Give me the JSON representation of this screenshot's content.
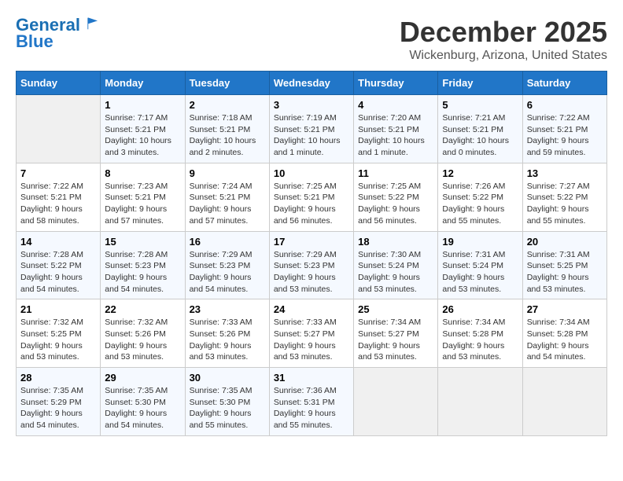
{
  "header": {
    "logo_line1": "General",
    "logo_line2": "Blue",
    "title": "December 2025",
    "subtitle": "Wickenburg, Arizona, United States"
  },
  "days_of_week": [
    "Sunday",
    "Monday",
    "Tuesday",
    "Wednesday",
    "Thursday",
    "Friday",
    "Saturday"
  ],
  "weeks": [
    [
      {
        "day": "",
        "detail": ""
      },
      {
        "day": "1",
        "detail": "Sunrise: 7:17 AM\nSunset: 5:21 PM\nDaylight: 10 hours\nand 3 minutes."
      },
      {
        "day": "2",
        "detail": "Sunrise: 7:18 AM\nSunset: 5:21 PM\nDaylight: 10 hours\nand 2 minutes."
      },
      {
        "day": "3",
        "detail": "Sunrise: 7:19 AM\nSunset: 5:21 PM\nDaylight: 10 hours\nand 1 minute."
      },
      {
        "day": "4",
        "detail": "Sunrise: 7:20 AM\nSunset: 5:21 PM\nDaylight: 10 hours\nand 1 minute."
      },
      {
        "day": "5",
        "detail": "Sunrise: 7:21 AM\nSunset: 5:21 PM\nDaylight: 10 hours\nand 0 minutes."
      },
      {
        "day": "6",
        "detail": "Sunrise: 7:22 AM\nSunset: 5:21 PM\nDaylight: 9 hours\nand 59 minutes."
      }
    ],
    [
      {
        "day": "7",
        "detail": "Sunrise: 7:22 AM\nSunset: 5:21 PM\nDaylight: 9 hours\nand 58 minutes."
      },
      {
        "day": "8",
        "detail": "Sunrise: 7:23 AM\nSunset: 5:21 PM\nDaylight: 9 hours\nand 57 minutes."
      },
      {
        "day": "9",
        "detail": "Sunrise: 7:24 AM\nSunset: 5:21 PM\nDaylight: 9 hours\nand 57 minutes."
      },
      {
        "day": "10",
        "detail": "Sunrise: 7:25 AM\nSunset: 5:21 PM\nDaylight: 9 hours\nand 56 minutes."
      },
      {
        "day": "11",
        "detail": "Sunrise: 7:25 AM\nSunset: 5:22 PM\nDaylight: 9 hours\nand 56 minutes."
      },
      {
        "day": "12",
        "detail": "Sunrise: 7:26 AM\nSunset: 5:22 PM\nDaylight: 9 hours\nand 55 minutes."
      },
      {
        "day": "13",
        "detail": "Sunrise: 7:27 AM\nSunset: 5:22 PM\nDaylight: 9 hours\nand 55 minutes."
      }
    ],
    [
      {
        "day": "14",
        "detail": "Sunrise: 7:28 AM\nSunset: 5:22 PM\nDaylight: 9 hours\nand 54 minutes."
      },
      {
        "day": "15",
        "detail": "Sunrise: 7:28 AM\nSunset: 5:23 PM\nDaylight: 9 hours\nand 54 minutes."
      },
      {
        "day": "16",
        "detail": "Sunrise: 7:29 AM\nSunset: 5:23 PM\nDaylight: 9 hours\nand 54 minutes."
      },
      {
        "day": "17",
        "detail": "Sunrise: 7:29 AM\nSunset: 5:23 PM\nDaylight: 9 hours\nand 53 minutes."
      },
      {
        "day": "18",
        "detail": "Sunrise: 7:30 AM\nSunset: 5:24 PM\nDaylight: 9 hours\nand 53 minutes."
      },
      {
        "day": "19",
        "detail": "Sunrise: 7:31 AM\nSunset: 5:24 PM\nDaylight: 9 hours\nand 53 minutes."
      },
      {
        "day": "20",
        "detail": "Sunrise: 7:31 AM\nSunset: 5:25 PM\nDaylight: 9 hours\nand 53 minutes."
      }
    ],
    [
      {
        "day": "21",
        "detail": "Sunrise: 7:32 AM\nSunset: 5:25 PM\nDaylight: 9 hours\nand 53 minutes."
      },
      {
        "day": "22",
        "detail": "Sunrise: 7:32 AM\nSunset: 5:26 PM\nDaylight: 9 hours\nand 53 minutes."
      },
      {
        "day": "23",
        "detail": "Sunrise: 7:33 AM\nSunset: 5:26 PM\nDaylight: 9 hours\nand 53 minutes."
      },
      {
        "day": "24",
        "detail": "Sunrise: 7:33 AM\nSunset: 5:27 PM\nDaylight: 9 hours\nand 53 minutes."
      },
      {
        "day": "25",
        "detail": "Sunrise: 7:34 AM\nSunset: 5:27 PM\nDaylight: 9 hours\nand 53 minutes."
      },
      {
        "day": "26",
        "detail": "Sunrise: 7:34 AM\nSunset: 5:28 PM\nDaylight: 9 hours\nand 53 minutes."
      },
      {
        "day": "27",
        "detail": "Sunrise: 7:34 AM\nSunset: 5:28 PM\nDaylight: 9 hours\nand 54 minutes."
      }
    ],
    [
      {
        "day": "28",
        "detail": "Sunrise: 7:35 AM\nSunset: 5:29 PM\nDaylight: 9 hours\nand 54 minutes."
      },
      {
        "day": "29",
        "detail": "Sunrise: 7:35 AM\nSunset: 5:30 PM\nDaylight: 9 hours\nand 54 minutes."
      },
      {
        "day": "30",
        "detail": "Sunrise: 7:35 AM\nSunset: 5:30 PM\nDaylight: 9 hours\nand 55 minutes."
      },
      {
        "day": "31",
        "detail": "Sunrise: 7:36 AM\nSunset: 5:31 PM\nDaylight: 9 hours\nand 55 minutes."
      },
      {
        "day": "",
        "detail": ""
      },
      {
        "day": "",
        "detail": ""
      },
      {
        "day": "",
        "detail": ""
      }
    ]
  ]
}
